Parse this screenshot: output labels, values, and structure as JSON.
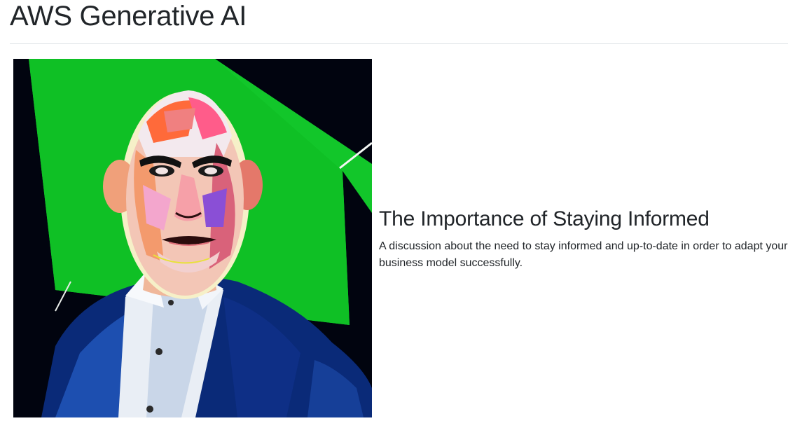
{
  "header": {
    "title": "AWS Generative AI"
  },
  "article": {
    "title": "The Importance of Staying Informed",
    "description": "A discussion about the need to stay informed and up-to-date in order to adapt your business model successfully."
  },
  "image": {
    "subject": "stylized pop-art portrait of a bald man in a navy suit and white shirt",
    "background_colors": [
      "#01040f",
      "#12c62a"
    ]
  }
}
